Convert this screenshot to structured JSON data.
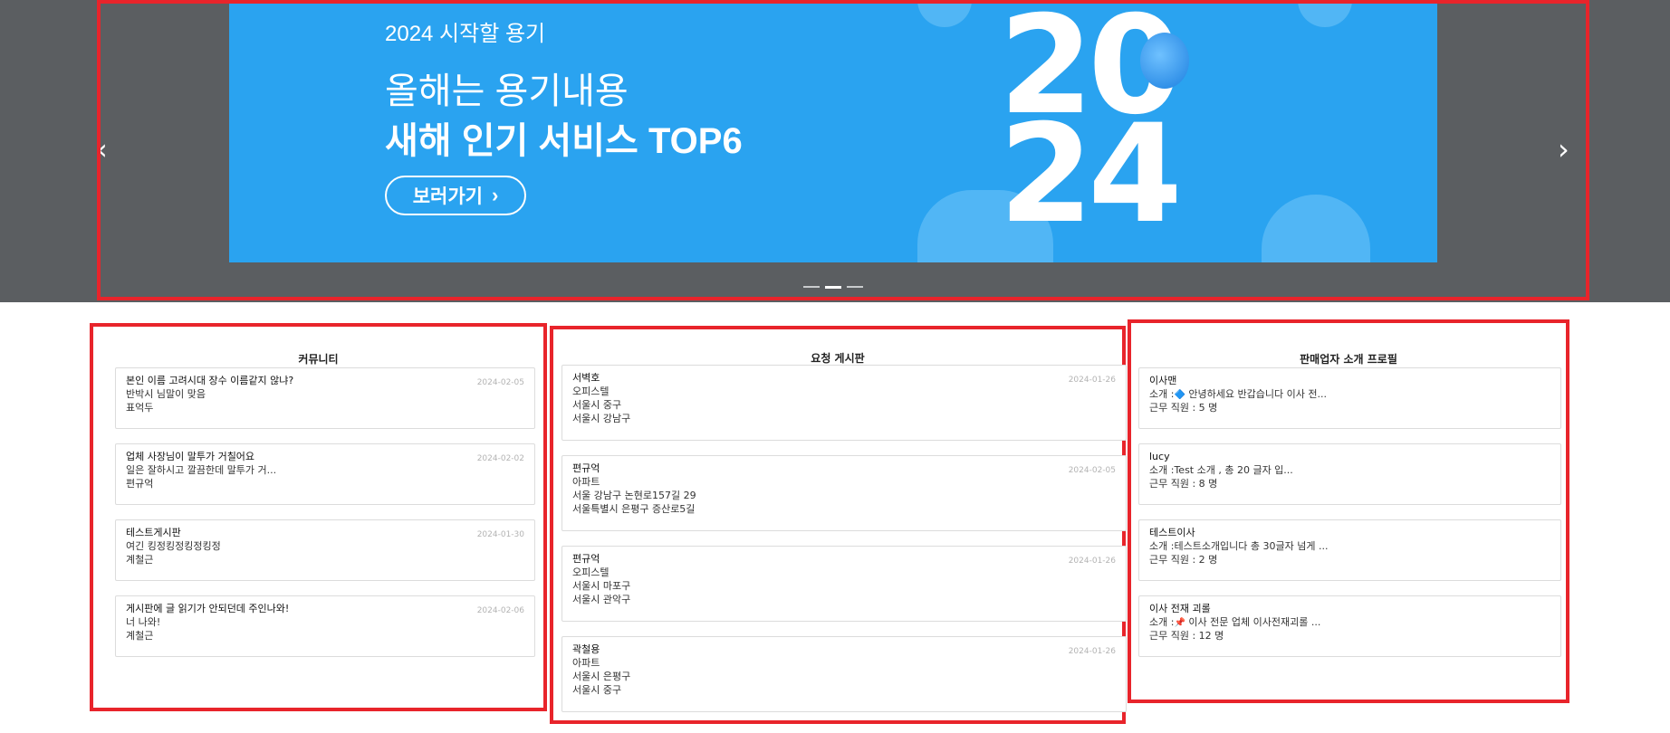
{
  "banner": {
    "subtitle": "2024 시작할 용기",
    "headline_1": "올해는 용기내용",
    "headline_2": "새해 인기 서비스 TOP6",
    "button_label": "보러가기",
    "year_top": "20",
    "year_bottom": "24",
    "prev_arrow": "‹",
    "next_arrow": "›",
    "slide_count": 3,
    "active_slide": 2,
    "colors": {
      "banner_bg": "#2aa3f0",
      "frame_bg": "#5b5e61",
      "highlight_border": "#e8242b"
    }
  },
  "community": {
    "title": "커뮤니티",
    "posts": [
      {
        "title": "본인 이름 고려시대 장수 이름같지 않냐?",
        "excerpt": "반박시 님말이 맞음",
        "author": "표억두",
        "date": "2024-02-05"
      },
      {
        "title": "업체 사장님이 말투가 거칠어요",
        "excerpt": "일은 잘하시고 깔끔한데 말투가 거...",
        "author": "편규억",
        "date": "2024-02-02"
      },
      {
        "title": "테스트게시판",
        "excerpt": "여긴 킹정킹정킹정킹정",
        "author": "계철근",
        "date": "2024-01-30"
      },
      {
        "title": "게시판에 글 읽기가 안되던데 주인나와!",
        "excerpt": "너 나와!",
        "author": "계철근",
        "date": "2024-02-06"
      }
    ]
  },
  "requests": {
    "title": "요청 게시판",
    "items": [
      {
        "name": "서벽호",
        "type": "오피스텔",
        "from": "서울시 중구",
        "to": "서울시 강남구",
        "date": "2024-01-26"
      },
      {
        "name": "편규억",
        "type": "아파트",
        "from": "서울 강남구 논현로157길 29",
        "to": "서울특별시 은평구 증산로5길",
        "date": "2024-02-05"
      },
      {
        "name": "편규억",
        "type": "오피스텔",
        "from": "서울시 마포구",
        "to": "서울시 관악구",
        "date": "2024-01-26"
      },
      {
        "name": "곽철용",
        "type": "아파트",
        "from": "서울시 은평구",
        "to": "서울시 중구",
        "date": "2024-01-26"
      }
    ]
  },
  "sellers": {
    "title": "판매업자 소개 프로필",
    "items": [
      {
        "name": "이사맨",
        "intro_prefix": "소개 :",
        "intro_emoji": "🔷",
        "intro_text": " 안녕하세요 반갑습니다 이사 전...",
        "staff": "근무 직원 : 5 명"
      },
      {
        "name": "lucy",
        "intro_prefix": "소개 :",
        "intro_emoji": "",
        "intro_text": "Test 소개 , 총 20 글자 입...",
        "staff": "근무 직원 : 8 명"
      },
      {
        "name": "테스트이사",
        "intro_prefix": "소개 :",
        "intro_emoji": "",
        "intro_text": "테스트소개입니다 총 30글자 넘게 ...",
        "staff": "근무 직원 : 2 명"
      },
      {
        "name": "이사 전재 괴롤",
        "intro_prefix": "소개 :",
        "intro_emoji": "📌",
        "intro_text": " 이사 전문 업체 이사전재괴롤 ...",
        "staff": "근무 직원 : 12 명"
      }
    ]
  }
}
